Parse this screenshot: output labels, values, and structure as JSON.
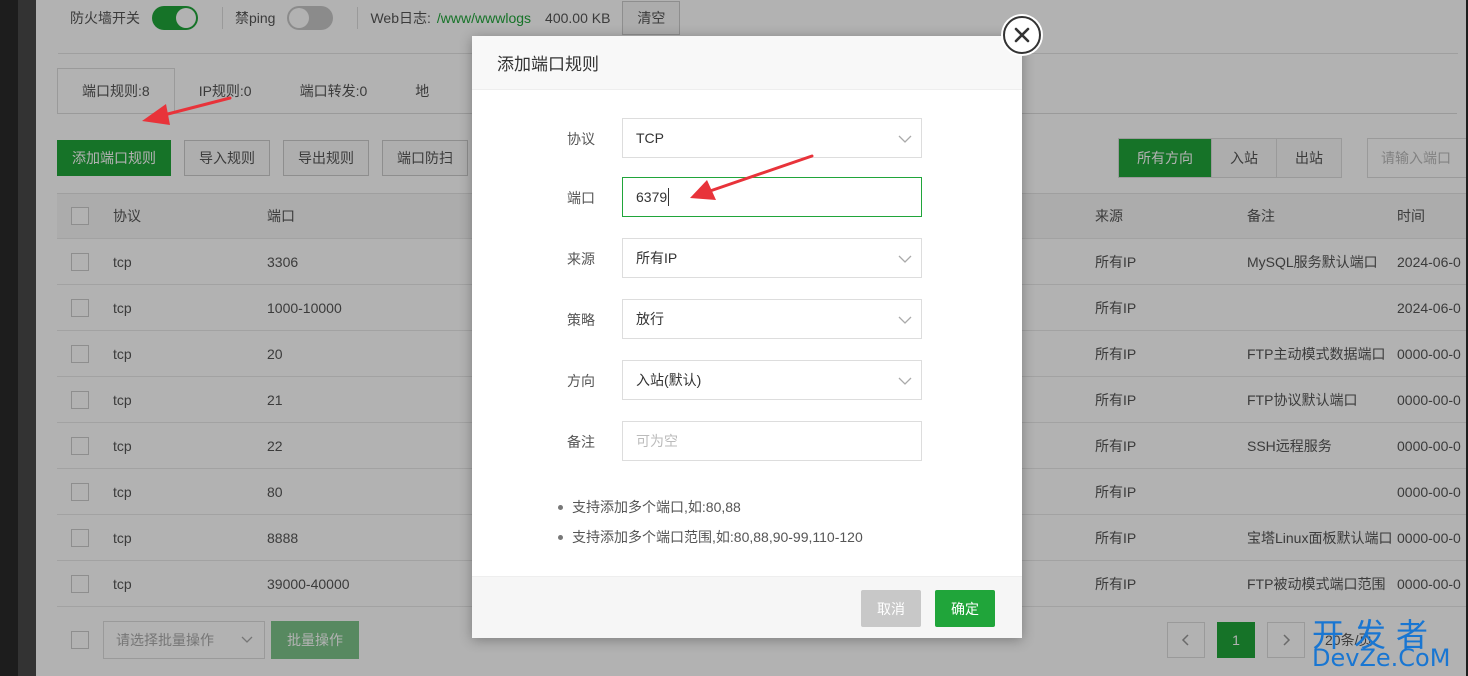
{
  "topbar": {
    "firewall_label": "防火墙开关",
    "firewall_on": true,
    "ping_label": "禁ping",
    "ping_on": false,
    "weblog_label": "Web日志:",
    "weblog_path": "/www/wwwlogs",
    "weblog_size": "400.00 KB",
    "clear_label": "清空"
  },
  "tabs": [
    {
      "label": "端口规则:8",
      "active": true
    },
    {
      "label": "IP规则:0",
      "active": false
    },
    {
      "label": "端口转发:0",
      "active": false
    },
    {
      "label": "地",
      "active": false
    }
  ],
  "toolbar": {
    "add_label": "添加端口规则",
    "import_label": "导入规则",
    "export_label": "导出规则",
    "scan_label": "端口防扫"
  },
  "direction_filter": {
    "options": [
      "所有方向",
      "入站",
      "出站"
    ],
    "selected": "所有方向"
  },
  "search": {
    "placeholder": "请输入端口"
  },
  "table": {
    "headers": {
      "protocol": "协议",
      "port": "端口",
      "source": "来源",
      "note": "备注",
      "time": "时间"
    },
    "rows": [
      {
        "protocol": "tcp",
        "port": "3306",
        "source": "所有IP",
        "note": "MySQL服务默认端口",
        "time": "2024-06-0"
      },
      {
        "protocol": "tcp",
        "port": "1000-10000",
        "source": "所有IP",
        "note": "",
        "time": "2024-06-0"
      },
      {
        "protocol": "tcp",
        "port": "20",
        "source": "所有IP",
        "note": "FTP主动模式数据端口",
        "time": "0000-00-0"
      },
      {
        "protocol": "tcp",
        "port": "21",
        "source": "所有IP",
        "note": "FTP协议默认端口",
        "time": "0000-00-0"
      },
      {
        "protocol": "tcp",
        "port": "22",
        "source": "所有IP",
        "note": "SSH远程服务",
        "time": "0000-00-0"
      },
      {
        "protocol": "tcp",
        "port": "80",
        "source": "所有IP",
        "note": "",
        "time": "0000-00-0"
      },
      {
        "protocol": "tcp",
        "port": "8888",
        "source": "所有IP",
        "note": "宝塔Linux面板默认端口",
        "time": "0000-00-0"
      },
      {
        "protocol": "tcp",
        "port": "39000-40000",
        "source": "所有IP",
        "note": "FTP被动模式端口范围",
        "time": "0000-00-0"
      }
    ]
  },
  "bottom": {
    "batch_placeholder": "请选择批量操作",
    "batch_button": "批量操作",
    "current_page": "1",
    "page_info": "20条/页"
  },
  "modal": {
    "title": "添加端口规则",
    "fields": {
      "protocol": {
        "label": "协议",
        "value": "TCP"
      },
      "port": {
        "label": "端口",
        "value": "6379"
      },
      "source": {
        "label": "来源",
        "value": "所有IP"
      },
      "strategy": {
        "label": "策略",
        "value": "放行"
      },
      "direction": {
        "label": "方向",
        "value": "入站(默认)"
      },
      "note": {
        "label": "备注",
        "placeholder": "可为空"
      }
    },
    "hints": [
      "支持添加多个端口,如:80,88",
      "支持添加多个端口范围,如:80,88,90-99,110-120"
    ],
    "cancel_label": "取消",
    "ok_label": "确定"
  },
  "watermark": {
    "line1": "开发者",
    "line2": "DevZe.CoM"
  },
  "colors": {
    "accent": "#20a53a",
    "annotation_arrow": "#e8333a"
  }
}
